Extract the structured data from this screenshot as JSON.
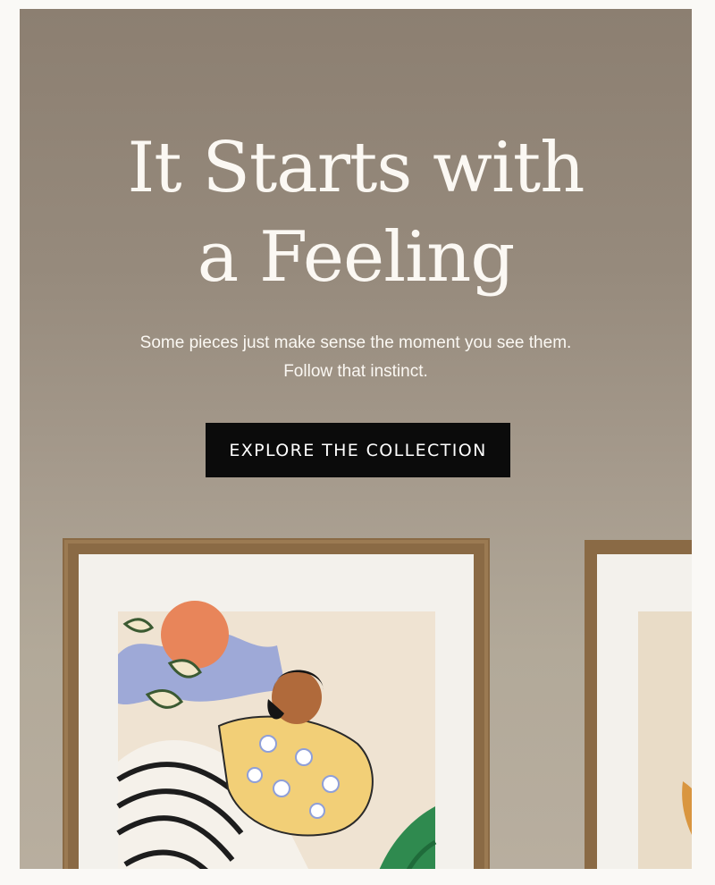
{
  "hero": {
    "headline_line1": "It Starts with",
    "headline_line2": "a Feeling",
    "subtitle": "Some pieces just make sense the moment you see them. Follow that instinct.",
    "cta_label": "EXPLORE THE COLLECTION"
  },
  "colors": {
    "wall": "#968a7c",
    "text": "#fbf8f3",
    "button": "#0b0b0b",
    "frame_wood": "#8a6a45",
    "mat": "#f3f1ec"
  }
}
